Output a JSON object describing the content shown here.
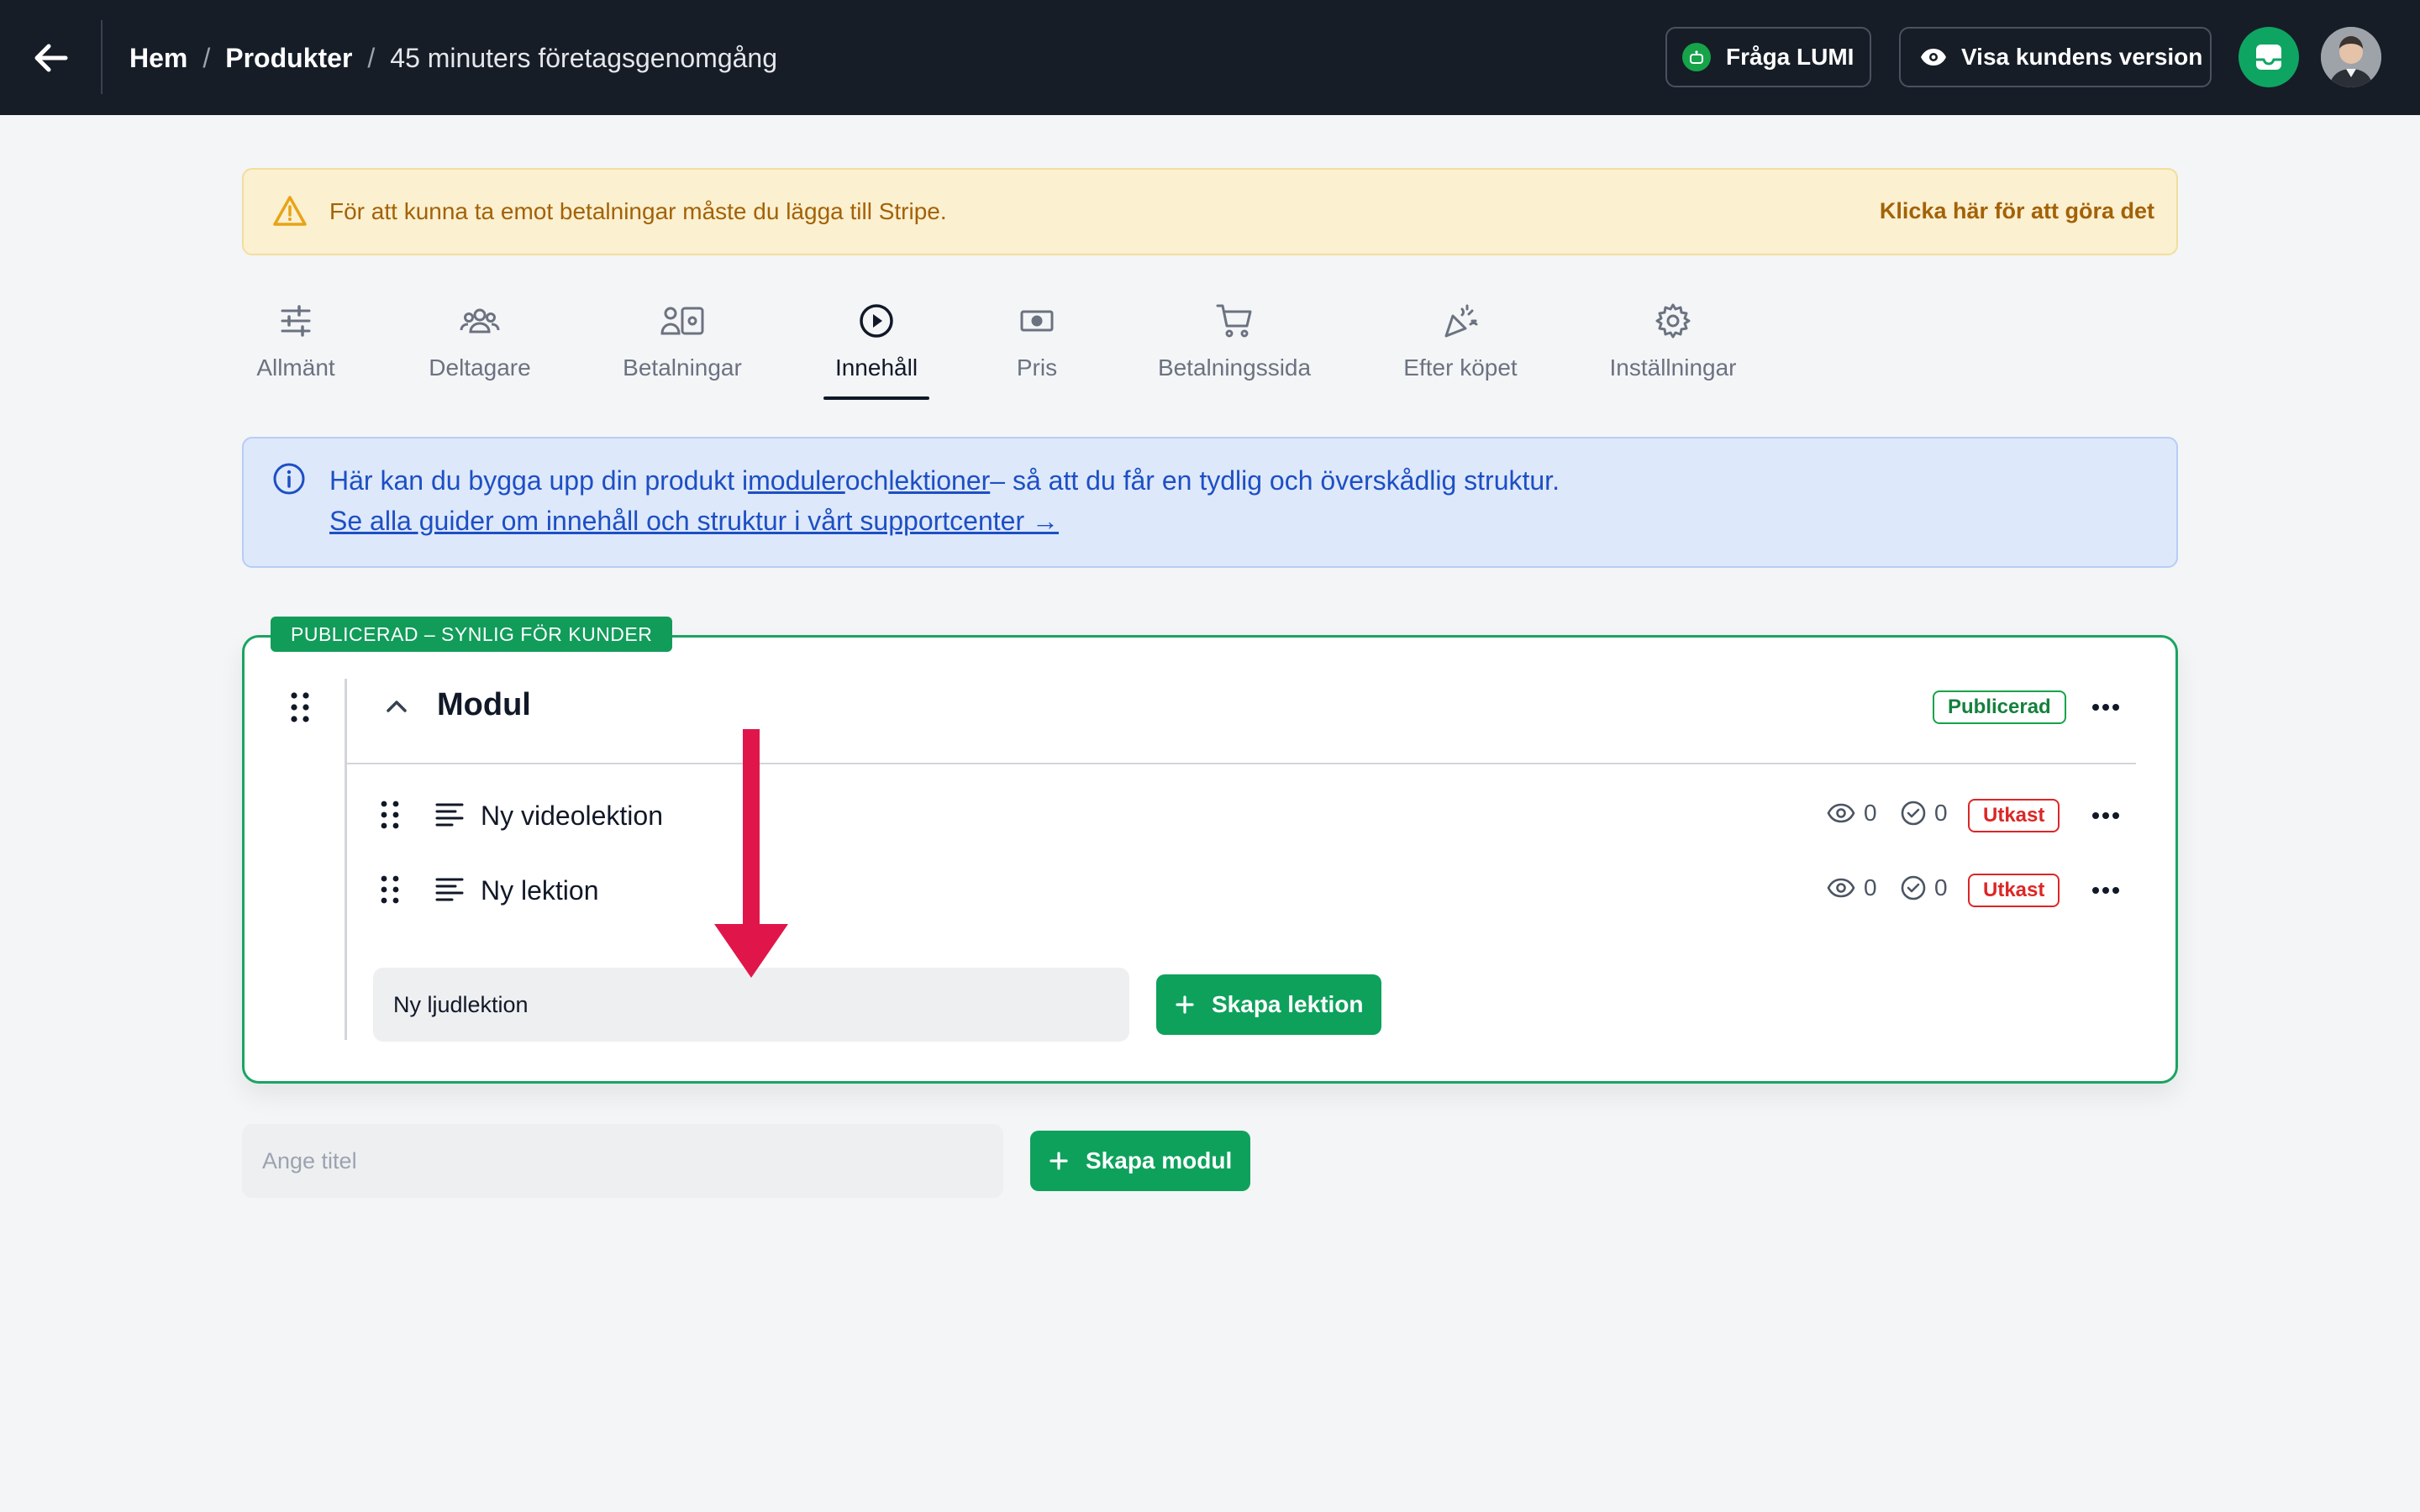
{
  "header": {
    "breadcrumb": [
      "Hem",
      "Produkter",
      "45 minuters företagsgenomgång"
    ],
    "separator": "/",
    "ask_lumi_label": "Fråga LUMI",
    "customer_view_label": "Visa kundens version"
  },
  "warning": {
    "text": "För att kunna ta emot betalningar måste du lägga till Stripe.",
    "link": "Klicka här för att göra det"
  },
  "tabs": [
    {
      "label": "Allmänt",
      "icon": "sliders-icon"
    },
    {
      "label": "Deltagare",
      "icon": "users-icon"
    },
    {
      "label": "Betalningar",
      "icon": "payments-icon"
    },
    {
      "label": "Innehåll",
      "icon": "play-circle-icon",
      "active": true
    },
    {
      "label": "Pris",
      "icon": "banknote-icon"
    },
    {
      "label": "Betalningssida",
      "icon": "cart-icon"
    },
    {
      "label": "Efter köpet",
      "icon": "party-popper-icon"
    },
    {
      "label": "Inställningar",
      "icon": "gear-icon"
    }
  ],
  "info": {
    "prefix": "Här kan du bygga upp din produkt i",
    "link_modules": "moduler",
    "middle": "och",
    "link_lessons": "lektioner",
    "suffix": "– så att du får en tydlig och överskådlig struktur.",
    "guide_link": "Se alla guider om innehåll och struktur i vårt supportcenter →"
  },
  "module": {
    "status_label": "PUBLICERAD – SYNLIG FÖR KUNDER",
    "title": "Modul",
    "badge": "Publicerad",
    "lessons": [
      {
        "title": "Ny videolektion",
        "views": "0",
        "completed": "0",
        "status": "Utkast"
      },
      {
        "title": "Ny lektion",
        "views": "0",
        "completed": "0",
        "status": "Utkast"
      }
    ],
    "new_lesson_value": "Ny ljudlektion",
    "create_lesson_label": "Skapa lektion"
  },
  "new_module": {
    "placeholder": "Ange titel",
    "create_module_label": "Skapa modul"
  },
  "colors": {
    "topbar": "#161d27",
    "brand_green": "#0ea15c",
    "warning_bg": "#fbf0d0",
    "info_bg": "#dde8fa",
    "draft_red": "#dc2626",
    "annotation_arrow": "#e0164a"
  }
}
